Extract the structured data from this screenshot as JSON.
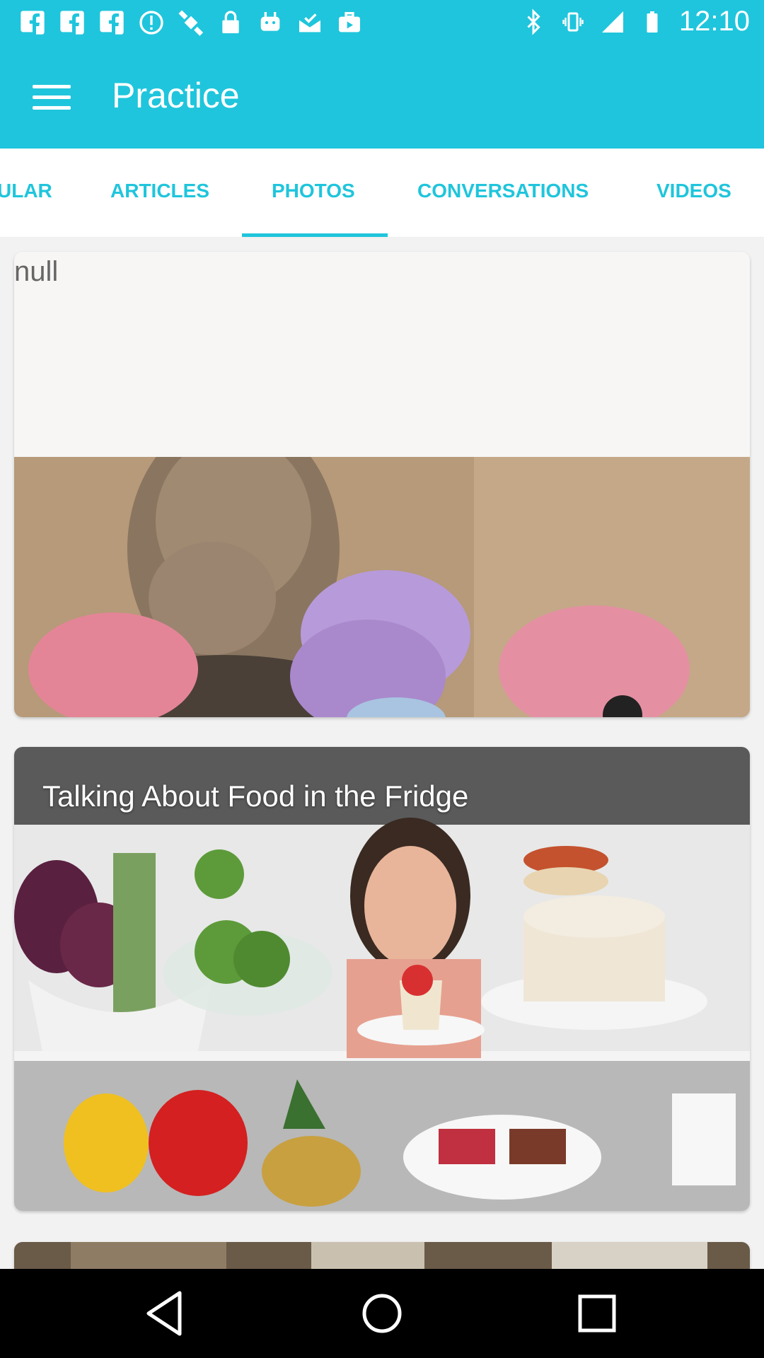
{
  "status_bar": {
    "time": "12:10",
    "icons_left": [
      "facebook-icon",
      "facebook-icon",
      "facebook-icon",
      "alert-icon",
      "fake-gps-icon",
      "lock-icon",
      "android-icon",
      "mail-check-icon",
      "briefcase-icon"
    ],
    "icons_right": [
      "bluetooth-icon",
      "vibrate-icon",
      "signal-icon",
      "battery-icon"
    ]
  },
  "app_bar": {
    "title": "Practice",
    "menu_icon": "hamburger-menu-icon"
  },
  "tabs": [
    {
      "label": "ULAR",
      "selected": false
    },
    {
      "label": "ARTICLES",
      "selected": false
    },
    {
      "label": "PHOTOS",
      "selected": true
    },
    {
      "label": "CONVERSATIONS",
      "selected": false
    },
    {
      "label": "VIDEOS",
      "selected": false
    }
  ],
  "feed": {
    "cards": [
      {
        "title": "null",
        "image": "animal-with-colorful-eggs-photo"
      },
      {
        "title": "Talking About Food in the Fridge",
        "image": "woman-looking-in-fridge-photo"
      },
      {
        "title": "",
        "image": "room-photo"
      }
    ]
  },
  "colors": {
    "primary": "#1fc5dc",
    "background": "#f2f2f2",
    "nav_bar": "#000000"
  },
  "nav_bar": {
    "buttons": [
      "back-icon",
      "home-icon",
      "recents-icon"
    ]
  }
}
